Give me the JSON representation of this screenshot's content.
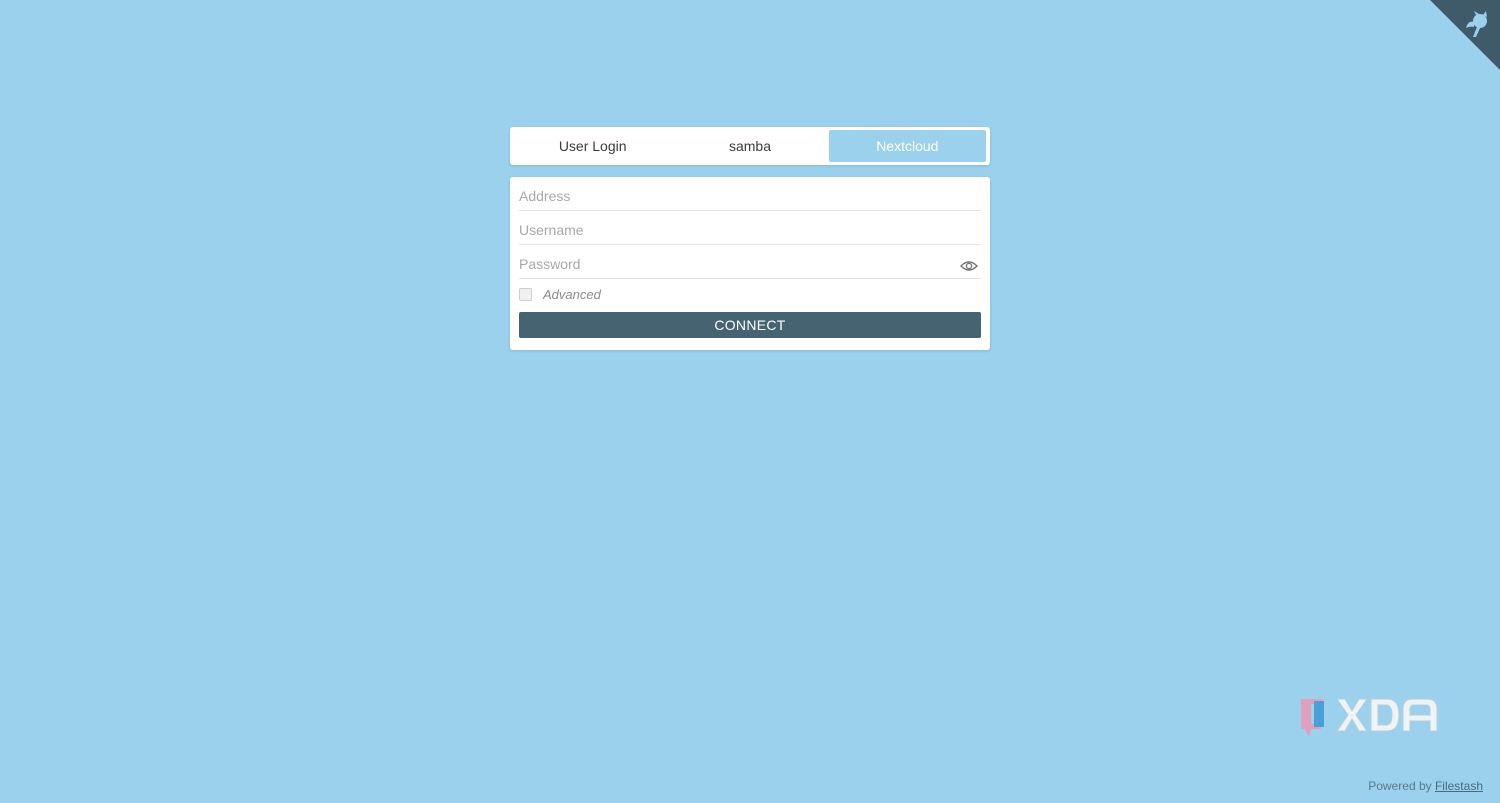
{
  "tabs": [
    {
      "label": "User Login",
      "active": false
    },
    {
      "label": "samba",
      "active": false
    },
    {
      "label": "Nextcloud",
      "active": true
    }
  ],
  "form": {
    "address_placeholder": "Address",
    "address_value": "",
    "username_placeholder": "Username",
    "username_value": "",
    "password_placeholder": "Password",
    "password_value": "",
    "advanced_label": "Advanced",
    "advanced_checked": false,
    "connect_label": "CONNECT"
  },
  "footer": {
    "prefix": "Powered by",
    "link": "Filestash"
  },
  "icons": {
    "corner": "github-corner-icon",
    "password_toggle": "eye-icon",
    "watermark": "xda-logo"
  },
  "colors": {
    "background": "#9bd1ec",
    "active_tab": "#9bd1ec",
    "connect_button": "#466372",
    "corner": "#3f5b6a"
  }
}
